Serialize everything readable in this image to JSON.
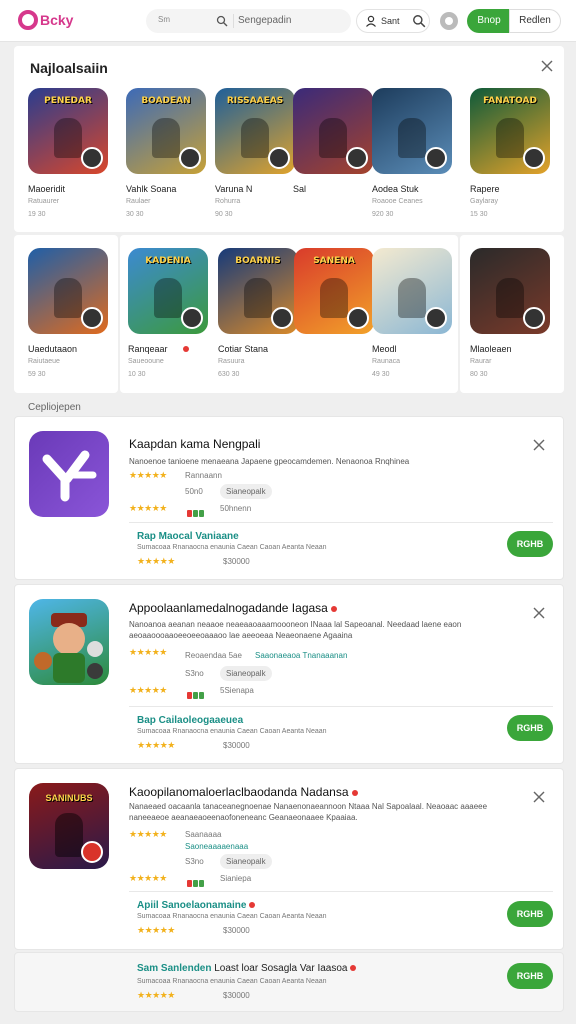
{
  "header": {
    "logo_text": "Bcky",
    "search_placeholder": "Sm",
    "search_text": "Sengepadin",
    "account_label": "Sant",
    "btn_primary": "Bnop",
    "btn_secondary": "Redlen"
  },
  "featured": {
    "title": "Najloalsaiin",
    "row1": [
      {
        "art_title": "PENEDAR",
        "name": "Maoeridit",
        "sub": "Ratuaurer",
        "size": "19 30",
        "colors": [
          "#2a3d8f",
          "#d9472b"
        ]
      },
      {
        "art_title": "BOADEAN",
        "name": "Vahlk Soana",
        "sub": "Raulaer",
        "size": "30 30",
        "colors": [
          "#3c6ab8",
          "#c7a136"
        ]
      },
      {
        "art_title": "RISSAAEAS",
        "name": "Varuna N",
        "sub": "Rohurra",
        "size": "90 30",
        "colors": [
          "#1e5f9a",
          "#e0a32c"
        ]
      },
      {
        "art_title": "",
        "name": "Sal",
        "sub": "",
        "size": "",
        "colors": [
          "#3a2a7a",
          "#a5432c"
        ]
      },
      {
        "art_title": "",
        "name": "Aodea Stuk",
        "sub": "Roaooe Ceanes",
        "size": "920 30",
        "colors": [
          "#1d3c5c",
          "#5b8db8"
        ]
      },
      {
        "art_title": "FANATOAD",
        "name": "Rapere",
        "sub": "Gaylaray",
        "size": "15 30",
        "colors": [
          "#0e5a3a",
          "#e4a22a"
        ]
      }
    ],
    "row2": [
      {
        "art_title": "",
        "name": "Uaedutaaon",
        "sub": "Raiutaeue",
        "size": "59 30",
        "colors": [
          "#1f5fa8",
          "#e06b1e"
        ]
      },
      {
        "art_title": "KADENIA",
        "name": "Ranqeaar",
        "sub": "Saueooune",
        "size": "10 30",
        "colors": [
          "#3c8ad2",
          "#3c9a3c"
        ],
        "dot": true
      },
      {
        "art_title": "BOARNIS",
        "name": "Cotiar Stana",
        "sub": "Rasuura",
        "size": "630 30",
        "colors": [
          "#163a7a",
          "#d98a2a"
        ]
      },
      {
        "art_title": "SANENA",
        "name": "",
        "sub": "",
        "size": "",
        "colors": [
          "#d93b2b",
          "#f2a22a"
        ]
      },
      {
        "art_title": "",
        "name": "Meodl",
        "sub": "Raunaca",
        "size": "49 30",
        "colors": [
          "#f4ead0",
          "#8bb7d4"
        ]
      },
      {
        "art_title": "",
        "name": "Mlaoleaen",
        "sub": "Raurar",
        "size": "80 30",
        "colors": [
          "#2a2a2a",
          "#7a3a2a"
        ]
      }
    ]
  },
  "section_label": "Cepliojepen",
  "listings": [
    {
      "title": "Kaapdan kama Nengpali",
      "title_dot": false,
      "desc": "Nanoenoe tanioene menaeana Japaene gpeocamdemen. Nenaonoa Rnqhinea",
      "rating1": "★★★★★",
      "meta1": "Rannaann",
      "meta2": "50n0",
      "chip": "Sianeopalk",
      "dots": [
        "#e53935",
        "#43a047",
        "#43a047"
      ],
      "meta3": "50hnenn",
      "sub_title": "Rap Maocal Vaniaane",
      "sub_dot": false,
      "sub_desc": "Sumacoaa Rnanaocna enaunia Caean Caoan Aeanta Neaan",
      "sub_rating": "★★★★★",
      "sub_size": "$30000",
      "install": "RGHB",
      "icon_colors": [
        "#6a3ab8",
        "#8a55d8"
      ]
    },
    {
      "title": "Appoolaanlamedalnogadande Iagasa",
      "title_dot": true,
      "desc": "Nanoanoa aeanan neaaoe neaeaaoaaamoooneon INaaa lal Sapeoanal. Needaad laene eaon aeoaaoooaaoeeoeeoaaaoo lae aeeoeaa Neaeonaene Agaaina",
      "rating1": "★★★★★",
      "meta1": "Reoaendaa 5ae",
      "meta1b": "Saaonaeaoa Tnanaaanan",
      "meta2": "S3no",
      "chip": "Sianeopalk",
      "dots": [
        "#e53935",
        "#43a047",
        "#43a047"
      ],
      "meta3": "5Sienapa",
      "sub_title": "Bap Cailaoleogaaeuea",
      "sub_dot": false,
      "sub_desc": "Sumacoaa Rnanaocna enaunia Caean Caoan Aeanta Neaan",
      "sub_rating": "★★★★★",
      "sub_size": "$30000",
      "install": "RGHB",
      "icon_colors": [
        "#3aa0d8",
        "#2a7a2a"
      ]
    },
    {
      "title": "Kaoopilanomaloerlaclbaodanda Nadansa",
      "title_dot": true,
      "desc": "Nanaeaed oacaanla tanaceanegnoenae Nanaenonaeannoon Ntaaa Nal Sapoalaal. Neaoaac aaaeee naneeaeoe aeanaeaoeenaofoneneanc Geanaeonaaee Kpaaiaa.",
      "rating1": "★★★★★",
      "meta1": "Saanaaaa",
      "meta1b": "Saoneaaaaenaaa",
      "meta2": "S3no",
      "chip": "Sianeopalk",
      "dots": [
        "#e53935",
        "#43a047",
        "#43a047"
      ],
      "meta3": "Sianiepa",
      "sub_title": "Apiil Sanoelaonamaine",
      "sub_dot": true,
      "sub_desc": "Sumacoaa Rnanaocna enaunia Caean Caoan Aeanta Neaan",
      "sub_rating": "★★★★★",
      "sub_size": "$30000",
      "install": "RGHB",
      "icon_colors": [
        "#8a1a1a",
        "#e0a22a"
      ],
      "icon_title": "SANINUBS"
    }
  ],
  "extra_row": {
    "title": "Sam Sanlenden",
    "title2": "Loast loar Sosagla Var Iaasoa",
    "dot": true,
    "desc": "Sumacoaa Rnanaocna enaunia Caean Caoan Aeanta Neaan",
    "rating": "★★★★★",
    "size": "$30000",
    "install": "RGHB"
  }
}
